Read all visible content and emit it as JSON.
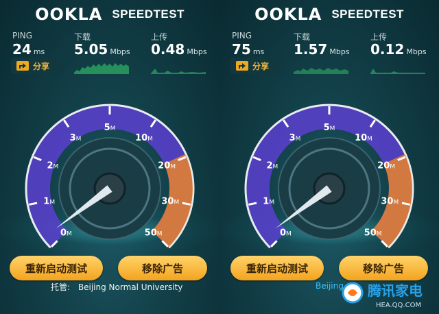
{
  "brand": {
    "logo": "OOKLA",
    "product": "SPEEDTEST"
  },
  "colors": {
    "accent_gold": "#f3a41e",
    "green_graph": "#39d36b",
    "purple_arc": "#7a5cf0",
    "orange_zone": "#f08a2a"
  },
  "panels": [
    {
      "ping_label": "PING",
      "ping_value": "24",
      "ping_unit": "ms",
      "download_label": "下载",
      "download_value": "5.05",
      "download_unit": "Mbps",
      "upload_label": "上传",
      "upload_value": "0.48",
      "upload_unit": "Mbps",
      "share_label": "分享",
      "retest_label": "重新启动测试",
      "remove_ads_label": "移除广告",
      "host_label": "托管:",
      "host_name": "Beijing Normal University"
    },
    {
      "ping_label": "PING",
      "ping_value": "75",
      "ping_unit": "ms",
      "download_label": "下载",
      "download_value": "1.57",
      "download_unit": "Mbps",
      "upload_label": "上传",
      "upload_value": "0.12",
      "upload_unit": "Mbps",
      "share_label": "分享",
      "retest_label": "重新启动测试",
      "remove_ads_label": "移除广告",
      "host_partial": "Beijing"
    }
  ],
  "gauge_ticks": [
    {
      "num": "0",
      "unit": "M"
    },
    {
      "num": "1",
      "unit": "M"
    },
    {
      "num": "2",
      "unit": "M"
    },
    {
      "num": "3",
      "unit": "M"
    },
    {
      "num": "5",
      "unit": "M"
    },
    {
      "num": "10",
      "unit": "M"
    },
    {
      "num": "20",
      "unit": "M"
    },
    {
      "num": "30",
      "unit": "M"
    },
    {
      "num": "50",
      "unit": "M"
    }
  ],
  "watermark": {
    "brand": "腾讯家电",
    "url": "HEA.QQ.COM"
  }
}
